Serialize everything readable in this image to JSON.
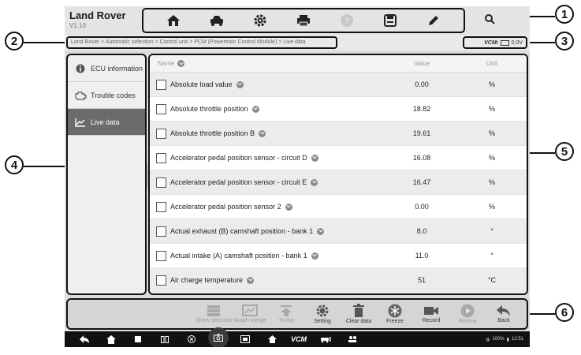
{
  "header": {
    "brand": "Land Rover",
    "version": "V1.10",
    "toolbar_icons": [
      "home-icon",
      "vehicle-icon",
      "settings-icon",
      "print-icon",
      "help-icon",
      "save-icon",
      "edit-icon"
    ]
  },
  "breadcrumb": "Land Rover > Automatic selection > Control unit > PCM (Powertrain Control Module) > Live data",
  "vci": {
    "label": "VCMi",
    "voltage": "0.0V"
  },
  "sidebar": {
    "items": [
      {
        "label": "ECU information",
        "icon": "info-icon"
      },
      {
        "label": "Trouble codes",
        "icon": "engine-icon"
      },
      {
        "label": "Live data",
        "icon": "graph-icon",
        "active": true
      }
    ]
  },
  "table": {
    "headers": {
      "name": "Name",
      "value": "Value",
      "unit": "Unit"
    },
    "rows": [
      {
        "name": "Absolute load value",
        "value": "0.00",
        "unit": "%"
      },
      {
        "name": "Absolute throttle position",
        "value": "18.82",
        "unit": "%"
      },
      {
        "name": "Absolute throttle position B",
        "value": "19.61",
        "unit": "%"
      },
      {
        "name": "Accelerator pedal position sensor - circuit D",
        "value": "16.08",
        "unit": "%"
      },
      {
        "name": "Accelerator pedal position sensor - circuit E",
        "value": "16.47",
        "unit": "%"
      },
      {
        "name": "Accelerator pedal position sensor 2",
        "value": "0.00",
        "unit": "%"
      },
      {
        "name": "Actual exhaust (B) camshaft position - bank 1",
        "value": "8.0",
        "unit": "°"
      },
      {
        "name": "Actual intake (A) camshaft position - bank 1",
        "value": "11.0",
        "unit": "°"
      },
      {
        "name": "Air charge temperature",
        "value": "51",
        "unit": "°C"
      }
    ]
  },
  "functions": {
    "show_selected": "Show selected",
    "graph_merge": "Graph merge",
    "to_top": "To top",
    "setting": "Setting",
    "clear_data": "Clear data",
    "freeze": "Freeze",
    "record": "Record",
    "review": "Review",
    "back": "Back"
  },
  "statusbar": {
    "battery": "100%",
    "time": "12:51"
  },
  "callouts": {
    "c1": "1",
    "c2": "2",
    "c3": "3",
    "c4": "4",
    "c5": "5",
    "c6": "6"
  }
}
